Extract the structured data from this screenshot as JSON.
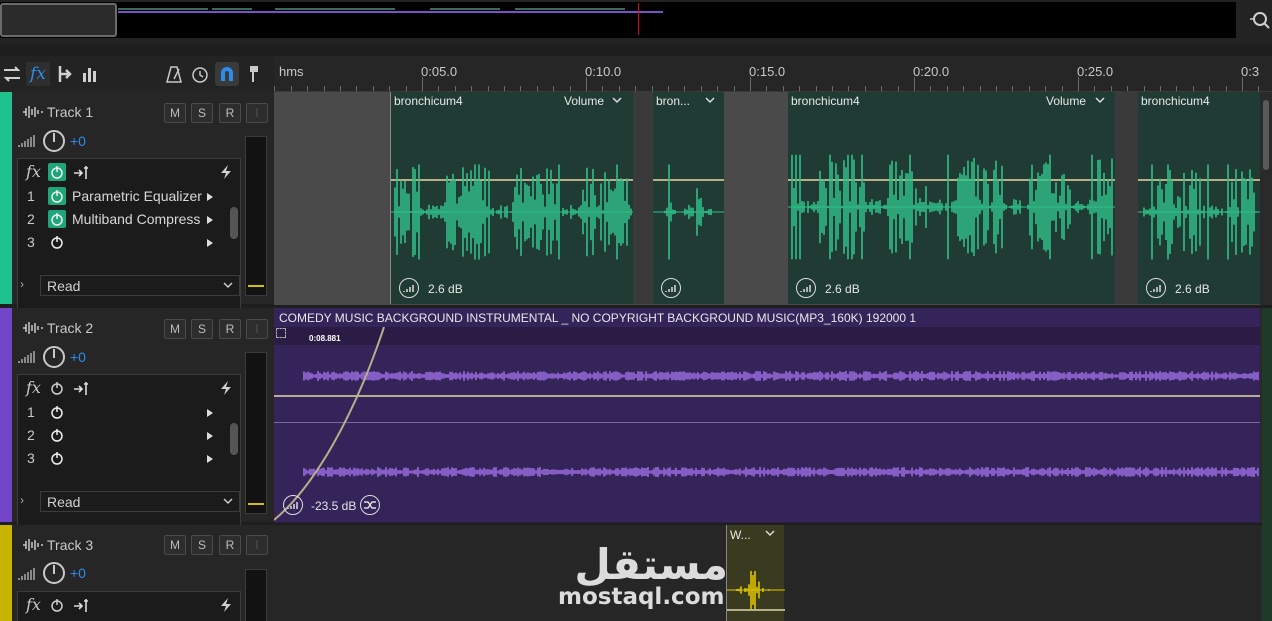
{
  "ruler": {
    "unit": "hms",
    "ticks": [
      "0:05.0",
      "0:10.0",
      "0:15.0",
      "0:20.0",
      "0:25.0",
      "0:3"
    ]
  },
  "tracks": [
    {
      "name": "Track 1",
      "color": "#1fc28c",
      "volume": "+0",
      "buttons": [
        "M",
        "S",
        "R",
        "I"
      ],
      "effects": [
        {
          "num": "1",
          "name": "Parametric Equalizer",
          "on": true
        },
        {
          "num": "2",
          "name": "Multiband Compress",
          "on": true
        },
        {
          "num": "3",
          "name": "",
          "on": false
        }
      ],
      "automation": "Read"
    },
    {
      "name": "Track 2",
      "color": "#7346c8",
      "volume": "+0",
      "buttons": [
        "M",
        "S",
        "R",
        "I"
      ],
      "effects": [
        {
          "num": "1",
          "name": "",
          "on": false
        },
        {
          "num": "2",
          "name": "",
          "on": false
        },
        {
          "num": "3",
          "name": "",
          "on": false
        }
      ],
      "automation": "Read"
    },
    {
      "name": "Track 3",
      "color": "#c8b400",
      "volume": "+0",
      "buttons": [
        "M",
        "S",
        "R",
        "I"
      ]
    }
  ],
  "clips_track1": [
    {
      "name": "bronchicum4",
      "volume_label": "Volume",
      "gain": "2.6 dB"
    },
    {
      "name": "bron...",
      "volume_label": "",
      "gain": ""
    },
    {
      "name": "bronchicum4",
      "volume_label": "Volume",
      "gain": "2.6 dB"
    },
    {
      "name": "bronchicum4",
      "volume_label": "",
      "gain": "2.6 dB"
    }
  ],
  "clip_track2": {
    "name": "COMEDY MUSIC BACKGROUND INSTRUMENTAL _ NO COPYRIGHT BACKGROUND MUSIC(MP3_160K) 192000 1",
    "fade_time": "0:08.881",
    "gain": "-23.5 dB"
  },
  "clip_track3": {
    "name": "W..."
  },
  "watermark": {
    "arabic": "مستقل",
    "latin": "mostaql.com"
  }
}
